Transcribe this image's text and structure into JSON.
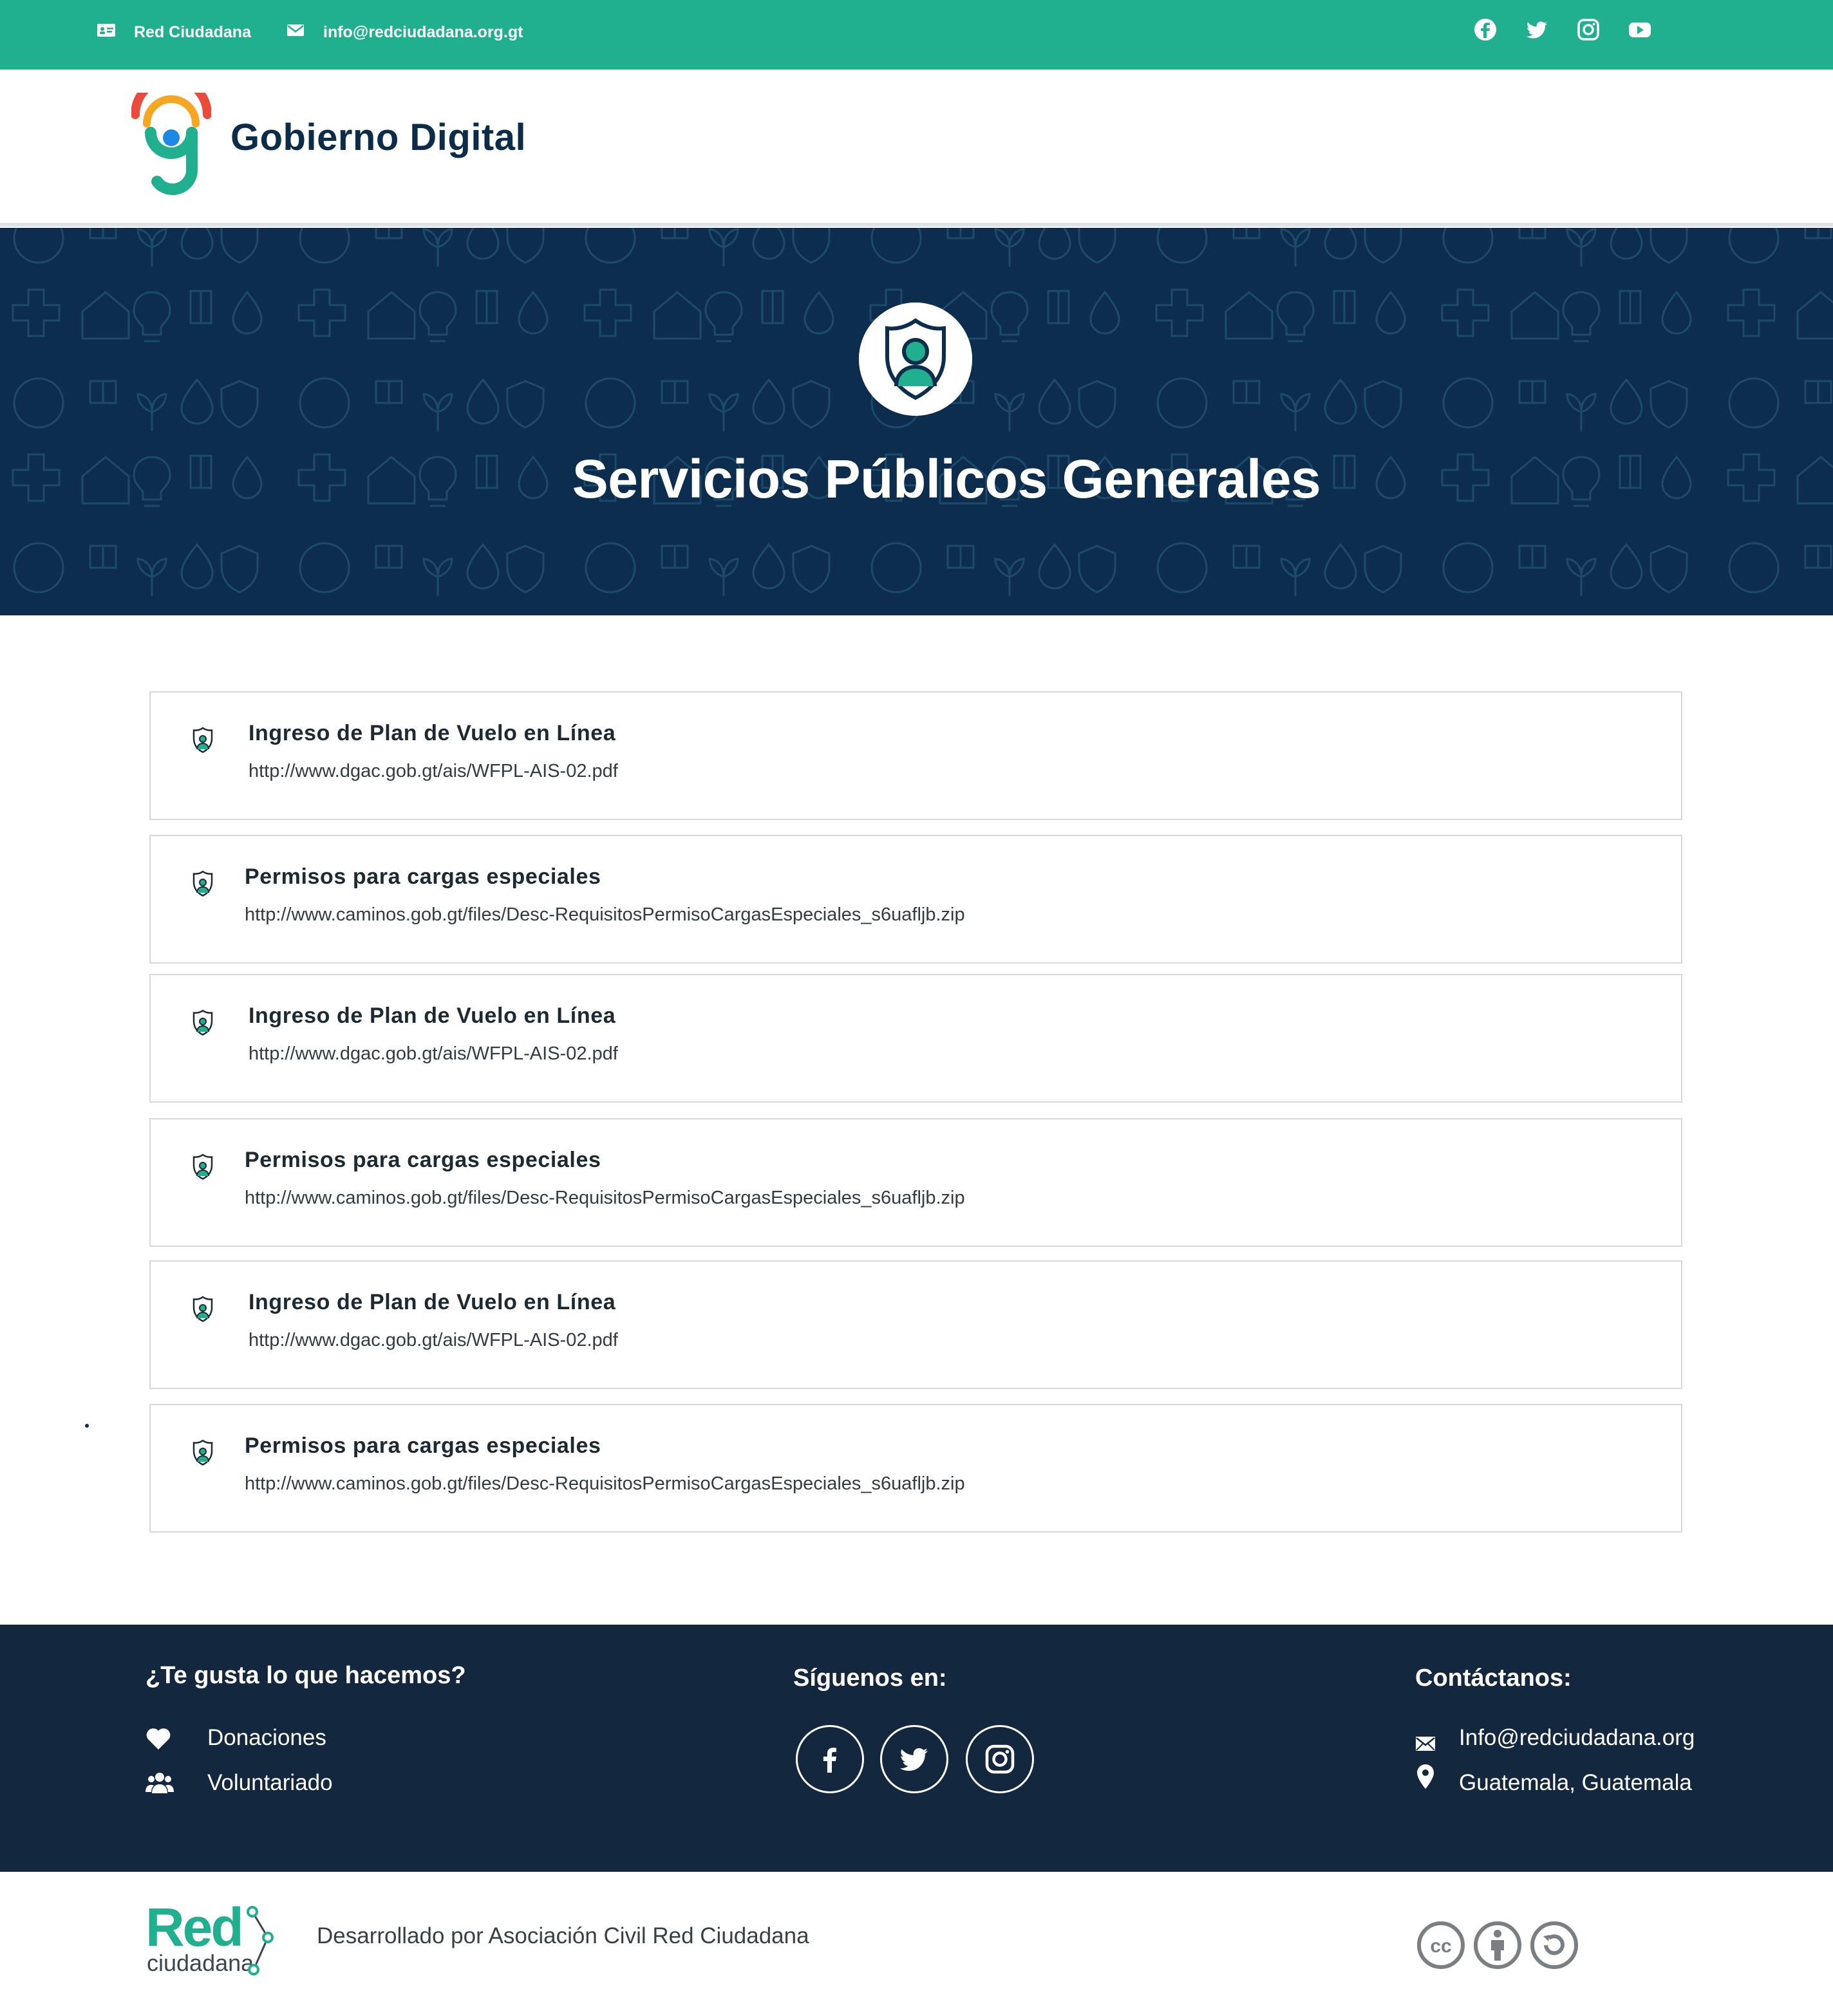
{
  "topbar": {
    "org_name": "Red Ciudadana",
    "email": "info@redciudadana.org.gt",
    "social_icons": [
      "facebook-icon",
      "twitter-icon",
      "instagram-icon",
      "youtube-icon"
    ]
  },
  "header": {
    "logo_text": "Gobierno Digital"
  },
  "hero": {
    "title": "Servicios Públicos Generales",
    "icon": "citizen-shield-icon"
  },
  "services": [
    {
      "title": "Ingreso de Plan de Vuelo en Línea",
      "link": "http://www.dgac.gob.gt/ais/WFPL-AIS-02.pdf"
    },
    {
      "title": "Permisos para cargas especiales",
      "link": "http://www.caminos.gob.gt/files/Desc-RequisitosPermisoCargasEspeciales_s6uafljb.zip"
    },
    {
      "title": "Ingreso de Plan de Vuelo en Línea",
      "link": "http://www.dgac.gob.gt/ais/WFPL-AIS-02.pdf"
    },
    {
      "title": "Permisos para cargas especiales",
      "link": "http://www.caminos.gob.gt/files/Desc-RequisitosPermisoCargasEspeciales_s6uafljb.zip"
    },
    {
      "title": "Ingreso de Plan de Vuelo en Línea",
      "link": "http://www.dgac.gob.gt/ais/WFPL-AIS-02.pdf"
    },
    {
      "title": "Permisos para cargas especiales",
      "link": "http://www.caminos.gob.gt/files/Desc-RequisitosPermisoCargasEspeciales_s6uafljb.zip"
    }
  ],
  "footer": {
    "support_heading": "¿Te gusta lo que hacemos?",
    "donations": "Donaciones",
    "volunteering": "Voluntariado",
    "follow_heading": "Síguenos en:",
    "contact_heading": "Contáctanos:",
    "contact_email": "Info@redciudadana.org",
    "location": "Guatemala, Guatemala"
  },
  "bottom": {
    "logo_red": "Red",
    "logo_ciudadana": "ciudadana",
    "developed_by": "Desarrollado por Asociación Civil Red Ciudadana",
    "license_icons": [
      "cc-icon",
      "by-icon",
      "sa-icon"
    ]
  },
  "colors": {
    "topbar": "#21b08f",
    "navy": "#0c2d4e",
    "footer": "#13273f",
    "teal": "#21b08f"
  }
}
